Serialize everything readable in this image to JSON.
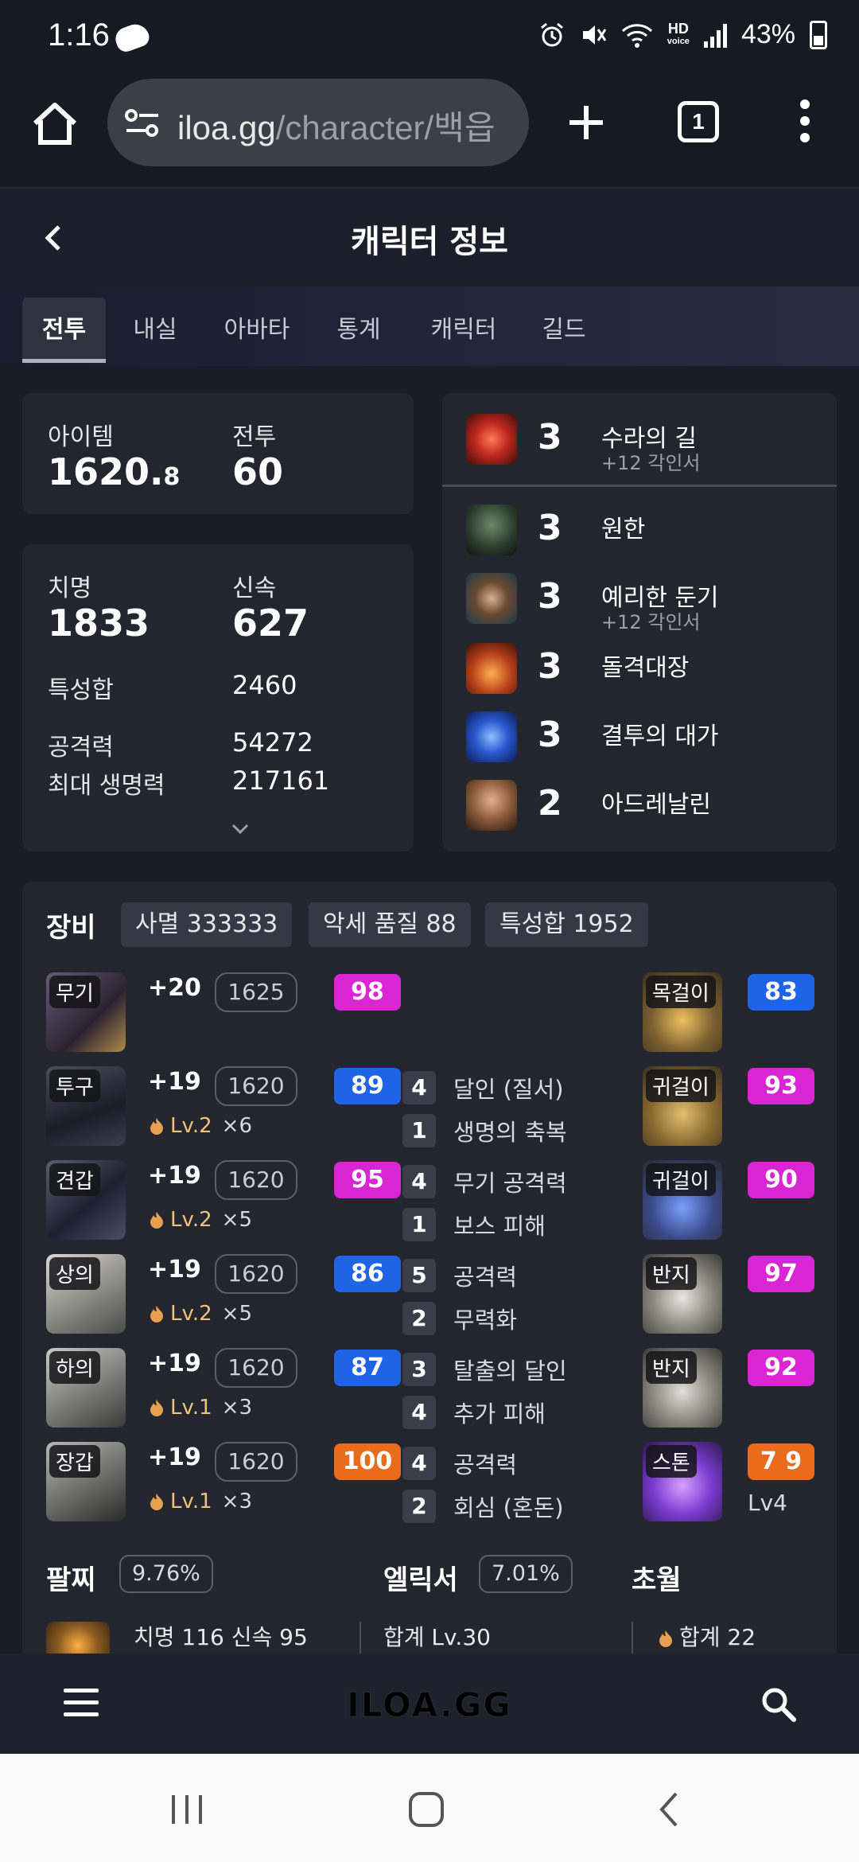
{
  "status_bar": {
    "time": "1:16",
    "battery": "43%",
    "hd_top": "HD",
    "hd_bottom": "voice"
  },
  "browser": {
    "url_host": "iloa.gg",
    "url_path": "/character/백읍",
    "tab_count": "1"
  },
  "header": {
    "title": "캐릭터 정보"
  },
  "tabs": [
    {
      "label": "전투",
      "active": true
    },
    {
      "label": "내실"
    },
    {
      "label": "아바타"
    },
    {
      "label": "통계"
    },
    {
      "label": "캐릭터"
    },
    {
      "label": "길드"
    }
  ],
  "summary": {
    "item_label": "아이템",
    "item_value": "1620.",
    "item_decimal": "8",
    "combat_label": "전투",
    "combat_value": "60"
  },
  "stats": {
    "crit_label": "치명",
    "crit_value": "1833",
    "swift_label": "신속",
    "swift_value": "627",
    "total_label": "특성합",
    "total_value": "2460",
    "atk_label": "공격력",
    "atk_value": "54272",
    "hp_label": "최대 생명력",
    "hp_value": "217161"
  },
  "engravings": [
    {
      "level": "3",
      "name": "수라의 길",
      "sub": "+12 각인서",
      "color": "#c0281e"
    },
    {
      "level": "3",
      "name": "원한",
      "sub": "",
      "color": "#3a6a4a"
    },
    {
      "level": "3",
      "name": "예리한 둔기",
      "sub": "+12 각인서",
      "color": "#6a4a30"
    },
    {
      "level": "3",
      "name": "돌격대장",
      "sub": "",
      "color": "#b8401a"
    },
    {
      "level": "3",
      "name": "결투의 대가",
      "sub": "",
      "color": "#2a5ad0"
    },
    {
      "level": "2",
      "name": "아드레날린",
      "sub": "",
      "color": "#8a5a3a"
    }
  ],
  "equipment": {
    "title": "장비",
    "chips": [
      "사멸 333333",
      "악세 품질 88",
      "특성합 1952"
    ],
    "items": [
      {
        "tag": "무기",
        "hone": "+20",
        "ilvl": "1625",
        "quality": "98",
        "qcolor": "pink",
        "trans_lv": "",
        "trans_x": ""
      },
      {
        "tag": "투구",
        "hone": "+19",
        "ilvl": "1620",
        "quality": "89",
        "qcolor": "blue",
        "trans_lv": "Lv.2",
        "trans_x": "×6"
      },
      {
        "tag": "견갑",
        "hone": "+19",
        "ilvl": "1620",
        "quality": "95",
        "qcolor": "pink",
        "trans_lv": "Lv.2",
        "trans_x": "×5"
      },
      {
        "tag": "상의",
        "hone": "+19",
        "ilvl": "1620",
        "quality": "86",
        "qcolor": "blue",
        "trans_lv": "Lv.2",
        "trans_x": "×5"
      },
      {
        "tag": "하의",
        "hone": "+19",
        "ilvl": "1620",
        "quality": "87",
        "qcolor": "blue",
        "trans_lv": "Lv.1",
        "trans_x": "×3"
      },
      {
        "tag": "장갑",
        "hone": "+19",
        "ilvl": "1620",
        "quality": "100",
        "qcolor": "orange",
        "trans_lv": "Lv.1",
        "trans_x": "×3"
      }
    ],
    "effects": [
      {
        "n": "4",
        "name": "달인 (질서)"
      },
      {
        "n": "1",
        "name": "생명의 축복"
      },
      {
        "n": "4",
        "name": "무기 공격력"
      },
      {
        "n": "1",
        "name": "보스 피해"
      },
      {
        "n": "5",
        "name": "공격력"
      },
      {
        "n": "2",
        "name": "무력화"
      },
      {
        "n": "3",
        "name": "탈출의 달인"
      },
      {
        "n": "4",
        "name": "추가 피해"
      },
      {
        "n": "4",
        "name": "공격력"
      },
      {
        "n": "2",
        "name": "회심 (혼돈)"
      }
    ],
    "accessories": [
      {
        "tag": "목걸이",
        "quality": "83",
        "qcolor": "blue"
      },
      {
        "tag": "귀걸이",
        "quality": "93",
        "qcolor": "pink"
      },
      {
        "tag": "귀걸이",
        "quality": "90",
        "qcolor": "pink"
      },
      {
        "tag": "반지",
        "quality": "97",
        "qcolor": "pink"
      },
      {
        "tag": "반지",
        "quality": "92",
        "qcolor": "pink"
      },
      {
        "tag": "스톤",
        "quality": "7 9",
        "qcolor": "orange",
        "extra": "Lv4"
      }
    ]
  },
  "bracelet": {
    "title": "팔찌",
    "pct": "9.76%",
    "text": "치명 116  신속 95"
  },
  "elixir": {
    "title": "엘릭서",
    "pct": "7.01%",
    "text": "합계 Lv.30"
  },
  "transcend": {
    "title": "초월",
    "text": "합계 22"
  },
  "site_nav": {
    "logo": "ILOA.GG"
  }
}
